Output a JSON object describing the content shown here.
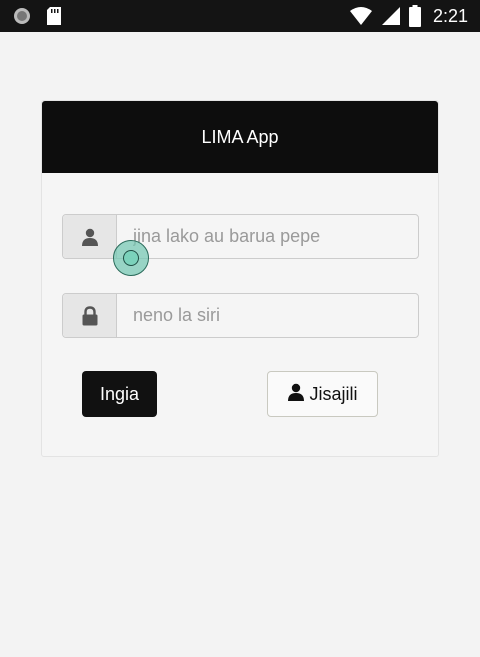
{
  "status_bar": {
    "time": "2:21",
    "icons": [
      "circle-notification-icon",
      "sd-card-icon",
      "wifi-icon",
      "signal-icon",
      "battery-icon"
    ]
  },
  "app": {
    "title": "LIMA App"
  },
  "login_form": {
    "username_placeholder": "jina lako au barua pepe",
    "username_value": "",
    "password_placeholder": "neno la siri",
    "password_value": "",
    "username_icon": "user-icon",
    "password_icon": "lock-icon",
    "login_label": "Ingia",
    "register_label": "Jisajili",
    "register_icon": "user-icon"
  },
  "colors": {
    "header_bg": "#0d0d0d",
    "page_bg": "#f3f3f3",
    "primary_button": "#111111",
    "touch_indicator": "#78c8b4"
  }
}
